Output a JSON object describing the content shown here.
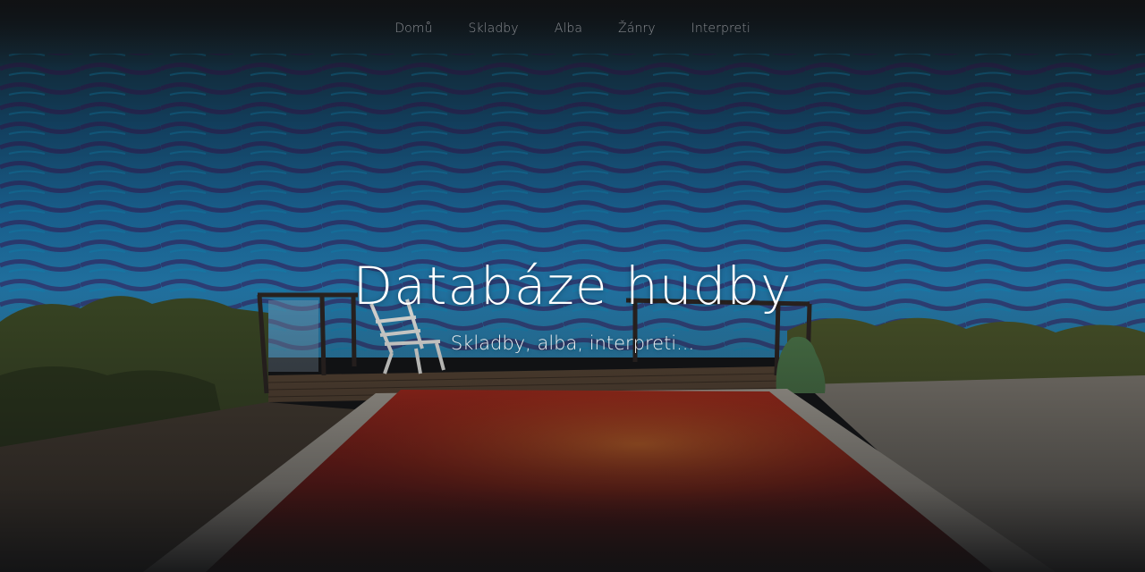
{
  "nav": {
    "items": [
      {
        "label": "Domů"
      },
      {
        "label": "Skladby"
      },
      {
        "label": "Alba"
      },
      {
        "label": "Žánry"
      },
      {
        "label": "Interpreti"
      }
    ]
  },
  "hero": {
    "title": "Databáze hudby",
    "subtitle": "Skladby, alba, interpreti..."
  },
  "colors": {
    "nav_text": "#8a8d92",
    "title_text": "#ffffff",
    "overlay": "#111214",
    "water": "#1b6fa0",
    "pool": "#a01a14"
  }
}
